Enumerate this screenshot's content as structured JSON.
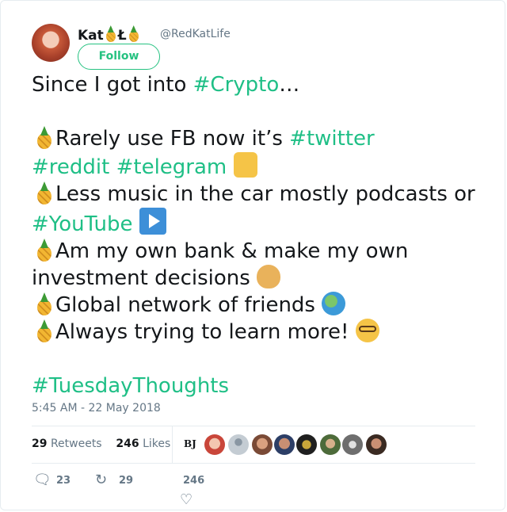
{
  "author": {
    "display_name_prefix": "Kat",
    "display_name_mid": "Ł",
    "handle": "@RedKatLife"
  },
  "follow_label": "Follow",
  "tweet": {
    "line1_a": "Since",
    "line1_b": "I got into ",
    "tag_crypto": "#Crypto",
    "ellipsis": "…",
    "item1_text": "Rarely use FB now it’s ",
    "tag_twitter": "#twitter",
    "tag_reddit": "#reddit",
    "tag_telegram": "#telegram",
    "item2_text": "Less music in the car mostly podcasts or ",
    "tag_youtube": "#YouTube",
    "item3_text": "Am my own bank & make my own investment decisions ",
    "item4_text": "Global network of friends ",
    "item5_text": "Always trying to learn more! ",
    "tag_tuesday": "#TuesdayThoughts"
  },
  "timestamp": "5:45 AM - 22 May 2018",
  "stats": {
    "retweets_count": "29",
    "retweets_label": "Retweets",
    "likes_count": "246",
    "likes_label": "Likes"
  },
  "likers_initials": "BJ",
  "actions": {
    "replies": "23",
    "retweets": "29",
    "likes": "246"
  },
  "colors": {
    "accent": "#1fbf86",
    "follow": "#26c281",
    "muted": "#657786"
  },
  "icons": [
    "pineapple-icon",
    "thumbs-up-icon",
    "play-button-icon",
    "money-bag-icon",
    "globe-icon",
    "nerd-face-icon",
    "reply-icon",
    "retweet-icon",
    "heart-icon"
  ]
}
